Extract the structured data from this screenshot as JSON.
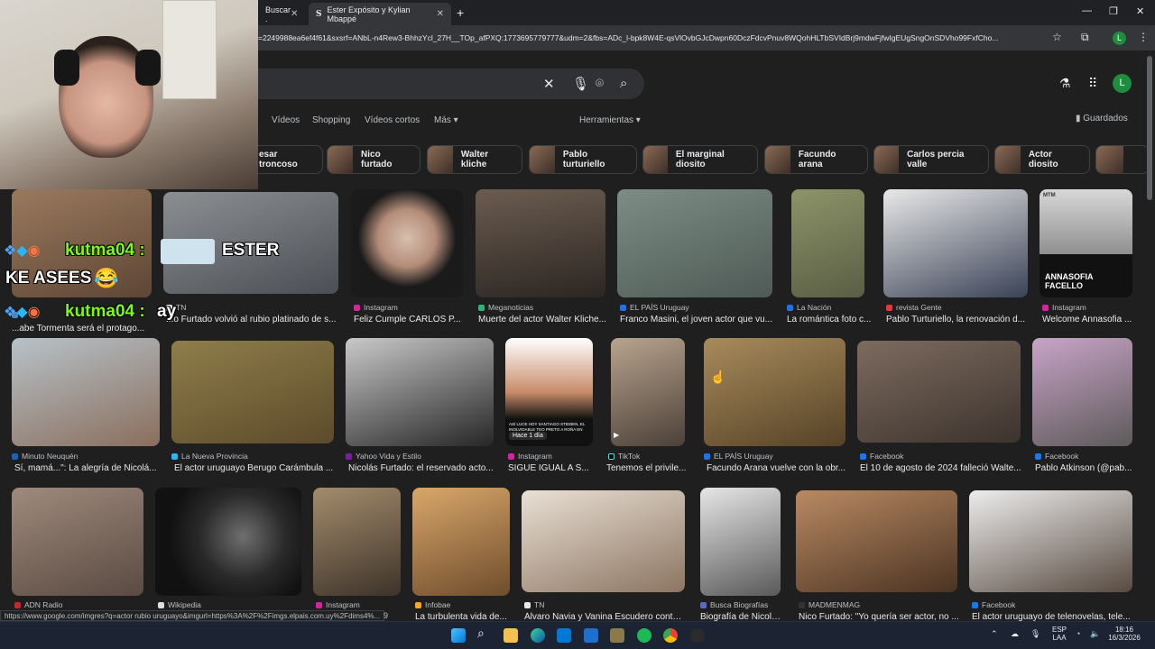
{
  "browser": {
    "tabs": [
      {
        "label": "Buscar ."
      },
      {
        "label": "Ester Expósito y Kylian Mbappé"
      }
    ],
    "new_tab": "+",
    "url": "=2249988ea6ef4f61&sxsrf=ANbL-n4Rew3-BhhzYcl_27H__TOp_afPXQ:1773695779777&udm=2&fbs=ADc_l-bpk8W4E-qsVlOvbGJcDwpn60DczFdcvPnuv8WQohHLTbSVIdBrj9mdwFjfwIgEUgSngOnSDVho99FxfCho...",
    "profile_initial": "L",
    "window": {
      "minimize": "—",
      "restore": "❐",
      "close": "✕"
    }
  },
  "google": {
    "profile_initial": "L",
    "nav": [
      "Vídeos",
      "Shopping",
      "Vídeos cortos",
      "Más ▾"
    ],
    "tools": "Herramientas ▾",
    "saved": "Guardados",
    "chips": [
      "esar troncoso",
      "Nico furtado",
      "Walter kliche",
      "Pablo turturiello",
      "El marginal diosito",
      "Facundo arana",
      "Carlos percia valle",
      "Actor diosito",
      ""
    ]
  },
  "overlay": {
    "chat1_user": "kutma04 :",
    "chat1_msg": "ESTER",
    "line2": "KE ASEES",
    "chat2_user": "kutma04 :",
    "chat2_msg": "ay"
  },
  "results": [
    {
      "src": "",
      "title": "...abe Tormenta será el protago..."
    },
    {
      "src": "TN",
      "title": "...o Furtado volvió al rubio platinado de s..."
    },
    {
      "src": "Instagram",
      "title": "Feliz Cumple CARLOS P..."
    },
    {
      "src": "Meganoticias",
      "title": "Muerte del actor Walter Kliche..."
    },
    {
      "src": "EL PAÍS Uruguay",
      "title": "Franco Masini, el joven actor que vu..."
    },
    {
      "src": "La Nación",
      "title": "La romántica foto c..."
    },
    {
      "src": "revista Gente",
      "title": "Pablo Turturiello, la renovación d..."
    },
    {
      "src": "Instagram",
      "title": "Welcome Annasofia ..."
    },
    {
      "src": "Minuto Neuquén",
      "title": "Sí, mamá...\": La alegría de Nicolá..."
    },
    {
      "src": "La Nueva Provincia",
      "title": "El actor uruguayo Berugo Carámbula ..."
    },
    {
      "src": "Yahoo Vida y Estilo",
      "title": "Nicolás Furtado: el reservado acto..."
    },
    {
      "src": "Instagram",
      "title": "SIGUE IGUAL A S..."
    },
    {
      "src": "TikTok",
      "title": "Tenemos el privile..."
    },
    {
      "src": "EL PAÍS Uruguay",
      "title": "Facundo Arana vuelve con la obr..."
    },
    {
      "src": "Facebook",
      "title": "El 10 de agosto de 2024 falleció Walte..."
    },
    {
      "src": "Facebook",
      "title": "Pablo Atkinson (@pab..."
    },
    {
      "src": "ADN Radio",
      "title": ""
    },
    {
      "src": "Wikipedia",
      "title": ""
    },
    {
      "src": "Instagram",
      "title": ""
    },
    {
      "src": "Infobae",
      "title": "La turbulenta vida de..."
    },
    {
      "src": "TN",
      "title": "Álvaro Navia y Vanina Escudero conta..."
    },
    {
      "src": "Busca Biografías",
      "title": "Biografía de Nicolá..."
    },
    {
      "src": "MADMENMAG",
      "title": "Nico Furtado: \"Yo quería ser actor, no ..."
    },
    {
      "src": "Facebook",
      "title": "El actor uruguayo de telenovelas, tele..."
    }
  ],
  "image_captions": {
    "annasofia": "ANNASOFIA FACELLO",
    "mtm": "MTM",
    "tiktok_time": "Hace 1 día",
    "insta_caption": "ASÍ LUCE HOY SANTIAGO STIEBEN, EL INOLVIDABLE TEO PRETO A ROÑA EN"
  },
  "status_url": "https://www.google.com/imgres?q=actor rubio uruguayo&imgurl=https%3A%2F%2Fimgs.elpais.com.uy%2Fdims4%...",
  "status_tail": "9",
  "taskbar": {
    "lang": "ESP",
    "lang2": "LAA",
    "time": "18:16",
    "date": "16/3/2026"
  }
}
